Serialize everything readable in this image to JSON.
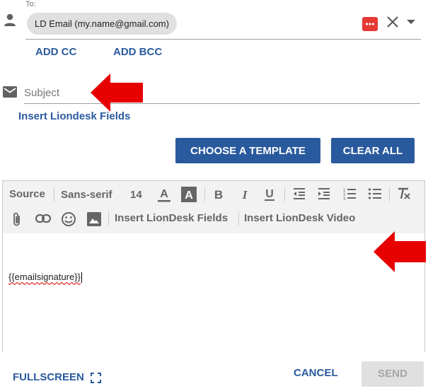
{
  "recipients": {
    "to_label": "To:",
    "chip_text": "LD Email (my.name@gmail.com)",
    "add_cc": "ADD CC",
    "add_bcc": "ADD BCC"
  },
  "subject": {
    "placeholder": "Subject",
    "value": ""
  },
  "insert_fields_link": "Insert Liondesk Fields",
  "actions": {
    "choose_template": "CHOOSE A TEMPLATE",
    "clear_all": "CLEAR ALL"
  },
  "toolbar": {
    "source": "Source",
    "font": "Sans-serif",
    "size": "14",
    "insert_fields": "Insert LionDesk Fields",
    "insert_video": "Insert LionDesk Video"
  },
  "editor": {
    "body_text": "{{emailsignature}}"
  },
  "footer": {
    "fullscreen": "FULLSCREEN",
    "cancel": "CANCEL",
    "send": "SEND"
  },
  "colors": {
    "accent": "#2a5a9e",
    "arrow": "#e60000",
    "more_button": "#e53935"
  },
  "icons": [
    "person-icon",
    "more-icon",
    "close-icon",
    "chevron-down-icon",
    "mail-icon",
    "text-color-icon",
    "background-color-icon",
    "bold-icon",
    "italic-icon",
    "underline-icon",
    "outdent-icon",
    "indent-icon",
    "numbered-list-icon",
    "bulleted-list-icon",
    "remove-format-icon",
    "attachment-icon",
    "link-icon",
    "emoji-icon",
    "image-icon",
    "fullscreen-icon",
    "annotation-arrow"
  ]
}
